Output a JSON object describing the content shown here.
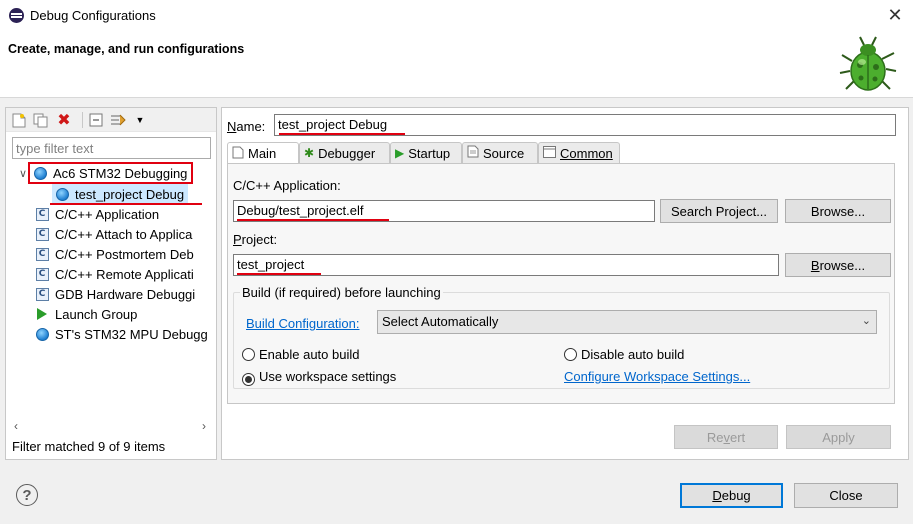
{
  "window": {
    "title": "Debug Configurations",
    "close_glyph": "✕"
  },
  "header": {
    "subtitle": "Create, manage, and run configurations"
  },
  "left": {
    "filter_placeholder": "type filter text",
    "tree": [
      {
        "label": "Ac6 STM32 Debugging",
        "icon": "globe-icon",
        "expanded": true
      },
      {
        "label": "test_project Debug",
        "icon": "globe-icon",
        "selected": true
      },
      {
        "label": "C/C++ Application",
        "icon": "c-icon"
      },
      {
        "label": "C/C++ Attach to Applica",
        "icon": "c-icon"
      },
      {
        "label": "C/C++ Postmortem Deb",
        "icon": "c-icon"
      },
      {
        "label": "C/C++ Remote Applicati",
        "icon": "c-icon"
      },
      {
        "label": "GDB Hardware Debuggi",
        "icon": "c-icon"
      },
      {
        "label": "Launch Group",
        "icon": "launch-icon"
      },
      {
        "label": "ST's STM32 MPU Debugg",
        "icon": "globe-icon"
      }
    ],
    "status": "Filter matched 9 of 9 items"
  },
  "right": {
    "name_label": "Name:",
    "name_value": "test_project Debug",
    "tabs": [
      {
        "label": "Main",
        "icon": "main-tab-icon",
        "active": true
      },
      {
        "label": "Debugger",
        "icon": "bug-tab-icon"
      },
      {
        "label": "Startup",
        "icon": "startup-tab-icon"
      },
      {
        "label": "Source",
        "icon": "source-tab-icon"
      },
      {
        "label": "Common",
        "icon": "common-tab-icon"
      }
    ],
    "app_label": "C/C++ Application:",
    "app_value": "Debug/test_project.elf",
    "search_project": "Search Project...",
    "browse1": "Browse...",
    "project_label": "Project:",
    "project_value": "test_project",
    "browse2": "Browse...",
    "build_group": "Build (if required) before launching",
    "build_config_link": "Build Configuration:",
    "build_config_value": "Select Automatically",
    "enable_auto": "Enable auto build",
    "disable_auto": "Disable auto build",
    "use_workspace": "Use workspace settings",
    "configure_link": "Configure Workspace Settings...",
    "revert": "Revert",
    "apply": "Apply"
  },
  "footer": {
    "debug": "Debug",
    "close": "Close",
    "help": "?"
  },
  "colors": {
    "accent": "#0078d7",
    "highlight": "#e00010",
    "selection": "#cce8ff"
  }
}
